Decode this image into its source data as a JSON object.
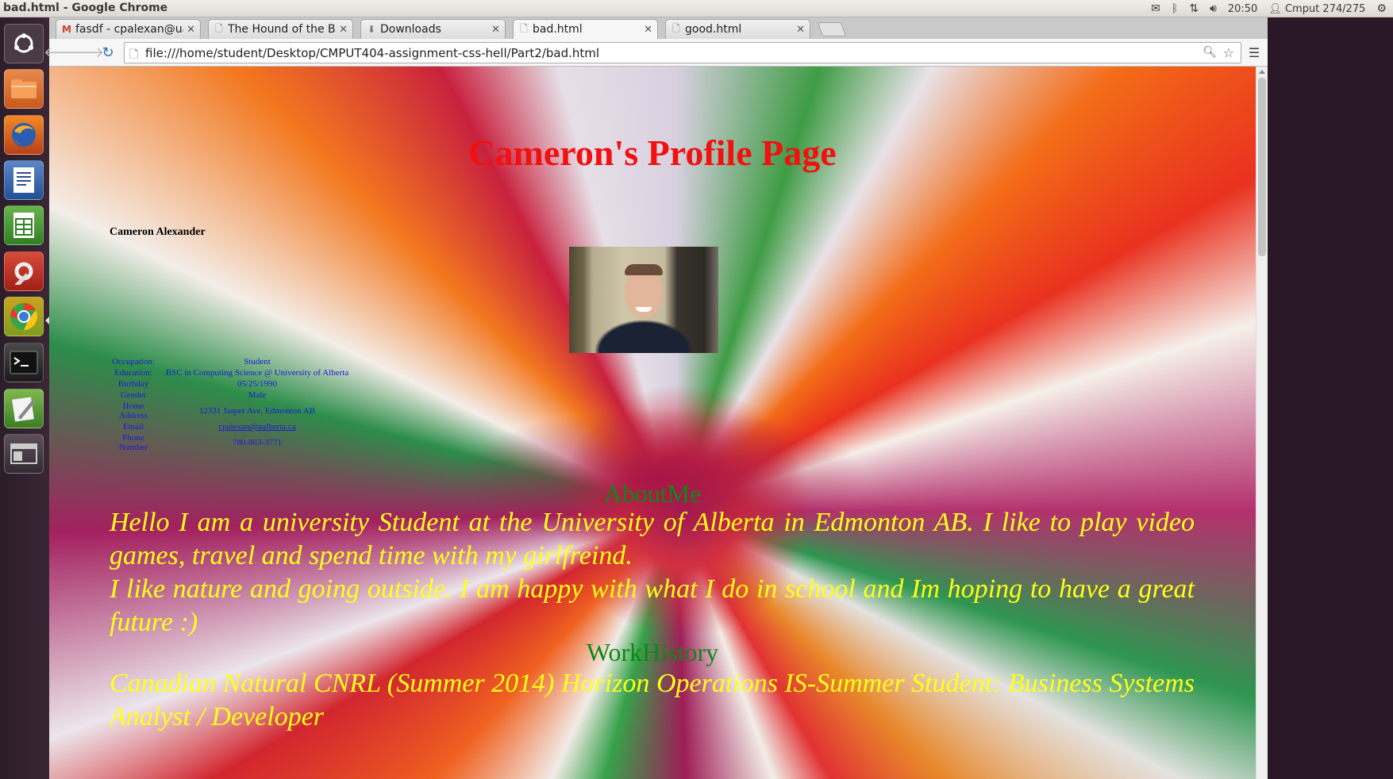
{
  "os_panel": {
    "window_title": "bad.html - Google Chrome",
    "clock": "20:50",
    "user": "Cmput 274/275",
    "icons": [
      "mail-icon",
      "bluetooth-icon",
      "network-icon",
      "volume-icon",
      "user-icon",
      "settings-gear-icon"
    ]
  },
  "launcher": {
    "items": [
      "dash-home",
      "files",
      "firefox",
      "libreoffice-writer",
      "libreoffice-calc",
      "system-settings",
      "chrome",
      "terminal",
      "text-editor",
      "workspace-switcher"
    ]
  },
  "browser": {
    "tabs": [
      {
        "title": "fasdf - cpalexan@ua",
        "icon": "gmail-icon",
        "active": false
      },
      {
        "title": "The Hound of the Ba",
        "icon": "page-icon",
        "active": false
      },
      {
        "title": "Downloads",
        "icon": "download-icon",
        "active": false
      },
      {
        "title": "bad.html",
        "icon": "page-icon",
        "active": true
      },
      {
        "title": "good.html",
        "icon": "page-icon",
        "active": false
      }
    ],
    "url": "file:///home/student/Desktop/CMPUT404-assignment-css-hell/Part2/bad.html"
  },
  "page": {
    "title": "Cameron's Profile Page",
    "name": "Cameron Alexander",
    "info_rows": [
      {
        "label": "Occupation:",
        "value": "Student"
      },
      {
        "label": "Education:",
        "value": "BSC in Computing Science @ University of Alberta"
      },
      {
        "label": "Birthday",
        "value": "05/25/1990"
      },
      {
        "label": "Gender",
        "value": "Male"
      },
      {
        "label": "Home Address",
        "value": "12331 Jasper Ave, Edmonton AB"
      },
      {
        "label": "Email",
        "value": "cpalexan@ualberta.ca"
      },
      {
        "label": "Phone Number",
        "value": "780-863-3771"
      }
    ],
    "about_heading": "AboutMe",
    "about_text_1": "Hello I am a university Student at the University of Alberta in Edmonton AB. I like to play video games, travel and spend time with my girlfreind.",
    "about_text_2": "I like nature and going outside. I am happy with what I do in school and Im hoping to have a great future :)",
    "work_heading": "WorkHistory",
    "work_text": "Canadian Natural CNRL (Summer 2014) Horizon Operations IS-Summer Student: Business Systems Analyst / Developer"
  },
  "colors": {
    "title": "#f21010",
    "headings": "#0a8a15",
    "body_text": "#ffff1a",
    "table_text": "#1b1bd6"
  }
}
